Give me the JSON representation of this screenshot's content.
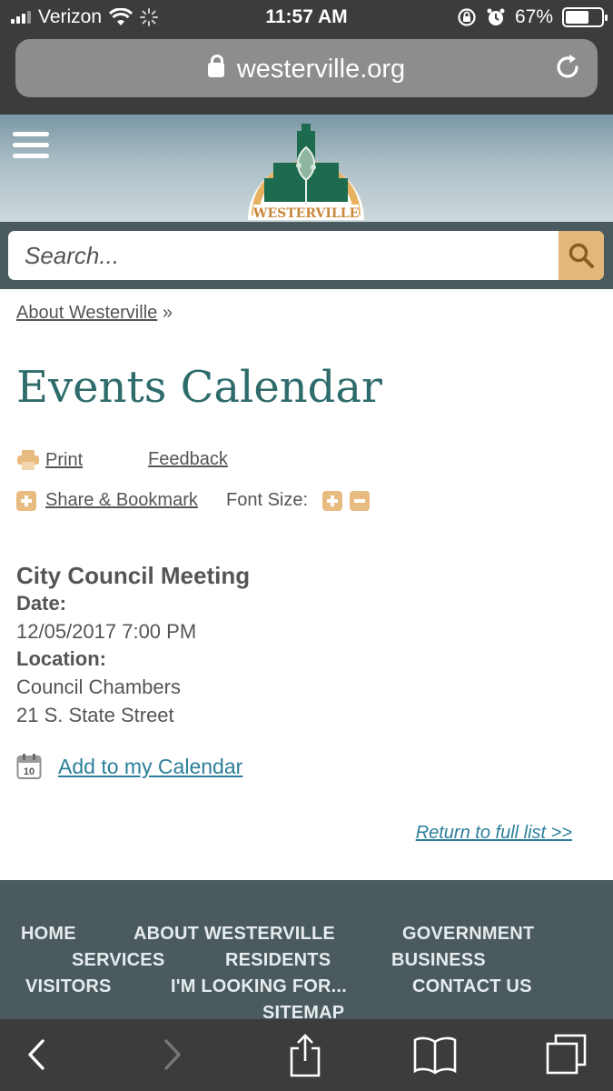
{
  "status_bar": {
    "carrier": "Verizon",
    "time": "11:57 AM",
    "battery_percent": "67%",
    "battery_level": 0.67
  },
  "browser": {
    "url": "westerville.org"
  },
  "site": {
    "logo_text": "WESTERVILLE",
    "search_placeholder": "Search..."
  },
  "breadcrumb": {
    "link": "About Westerville",
    "separator": "»"
  },
  "page": {
    "title": "Events Calendar"
  },
  "tools": {
    "print_label": "Print",
    "feedback_label": "Feedback",
    "share_label": "Share & Bookmark",
    "font_size_label": "Font Size:"
  },
  "event": {
    "title": "City Council Meeting",
    "date_label": "Date:",
    "date_value": "12/05/2017 7:00 PM",
    "location_label": "Location:",
    "location_line1": "Council Chambers",
    "location_line2": "21 S. State Street",
    "calendar_icon_day": "10",
    "add_calendar_label": "Add to my Calendar",
    "return_label": "Return to full list >>"
  },
  "footer": {
    "links": [
      "HOME",
      "ABOUT WESTERVILLE",
      "GOVERNMENT",
      "SERVICES",
      "RESIDENTS",
      "BUSINESS",
      "VISITORS",
      "I'M LOOKING FOR...",
      "CONTACT US",
      "SITEMAP"
    ]
  },
  "colors": {
    "title_teal": "#2e6b6b",
    "link_blue": "#2b7f9a",
    "accent_tan": "#e3b77a",
    "footer_bg": "#4a5a5e",
    "chrome_bg": "#3c3c3c"
  },
  "icons": [
    "signal-icon",
    "wifi-icon",
    "activity-spinner-icon",
    "rotation-lock-icon",
    "alarm-icon",
    "battery-icon",
    "lock-icon",
    "reload-icon",
    "hamburger-menu-icon",
    "search-icon",
    "print-icon",
    "plus-icon",
    "minus-icon",
    "calendar-icon",
    "back-arrow-icon",
    "forward-arrow-icon",
    "share-icon",
    "bookmarks-icon",
    "tabs-icon"
  ]
}
